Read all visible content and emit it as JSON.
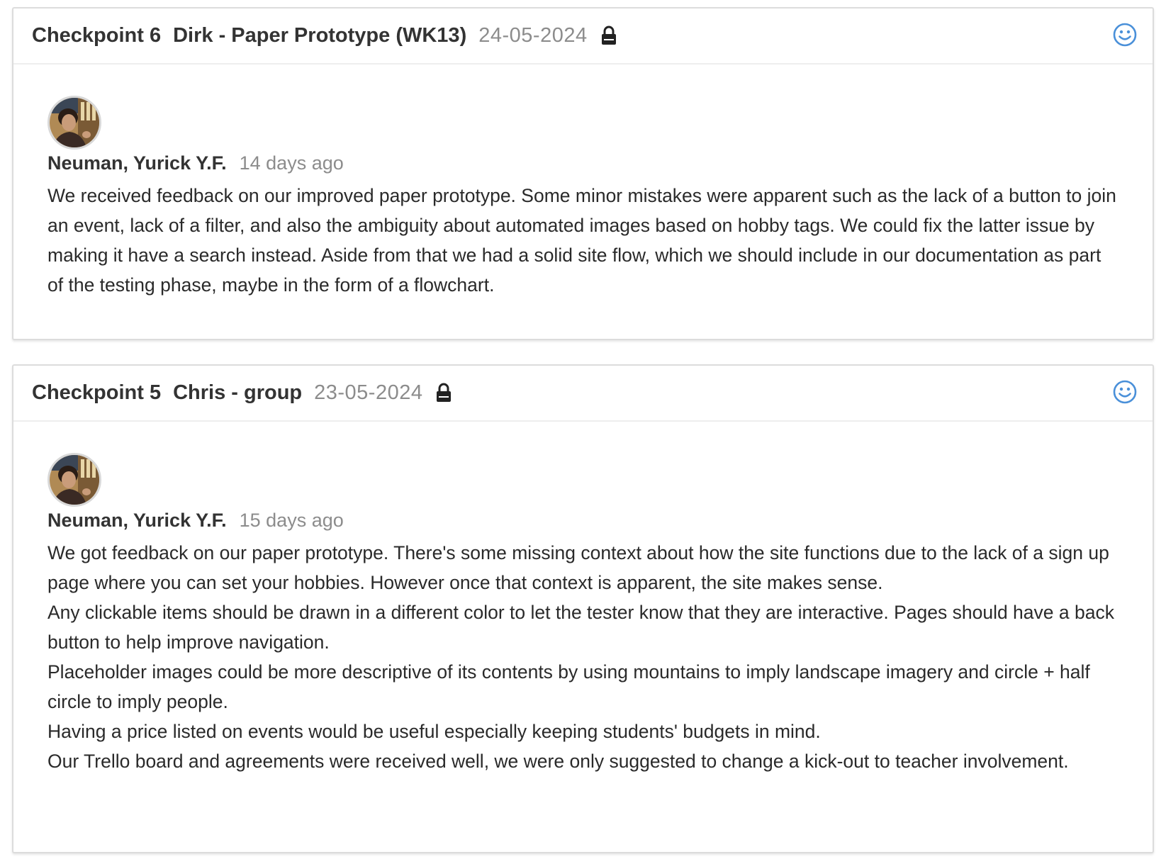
{
  "checkpoints": [
    {
      "label": "Checkpoint 6",
      "title": "Dirk - Paper Prototype (WK13)",
      "date": "24-05-2024",
      "lock_icon": "lock-icon",
      "status_icon": "smiley-icon",
      "author": "Neuman, Yurick Y.F.",
      "time_ago": "14 days ago",
      "paragraphs": [
        "We received feedback on our improved paper prototype. Some minor mistakes were apparent such as the lack of a button to join an event, lack of a filter, and also the ambiguity about automated images based on hobby tags. We could fix the latter issue by making it have a search instead. Aside from that we had a solid site flow, which we should include in our documentation as part of the testing phase, maybe in the form of a flowchart."
      ]
    },
    {
      "label": "Checkpoint 5",
      "title": "Chris - group",
      "date": "23-05-2024",
      "lock_icon": "lock-icon",
      "status_icon": "smiley-icon",
      "author": "Neuman, Yurick Y.F.",
      "time_ago": "15 days ago",
      "paragraphs": [
        "We got feedback on our paper prototype. There's some missing context about how the site functions due to the lack of a sign up page where you can set your hobbies. However once that context is apparent, the site makes sense.",
        "Any clickable items should be drawn in a different color to let the tester know that they are interactive. Pages should have a back button to help improve navigation.",
        "Placeholder images could be more descriptive of its contents by using mountains to imply landscape imagery and circle + half circle to imply people.",
        "Having a price listed on events would be useful especially keeping students' budgets in mind.",
        "Our Trello board and agreements were received well, we were only suggested to change a kick-out to teacher involvement."
      ]
    }
  ],
  "colors": {
    "accent": "#4a90d9",
    "muted_text": "#8c8c8c",
    "border": "#dcdcdc"
  }
}
